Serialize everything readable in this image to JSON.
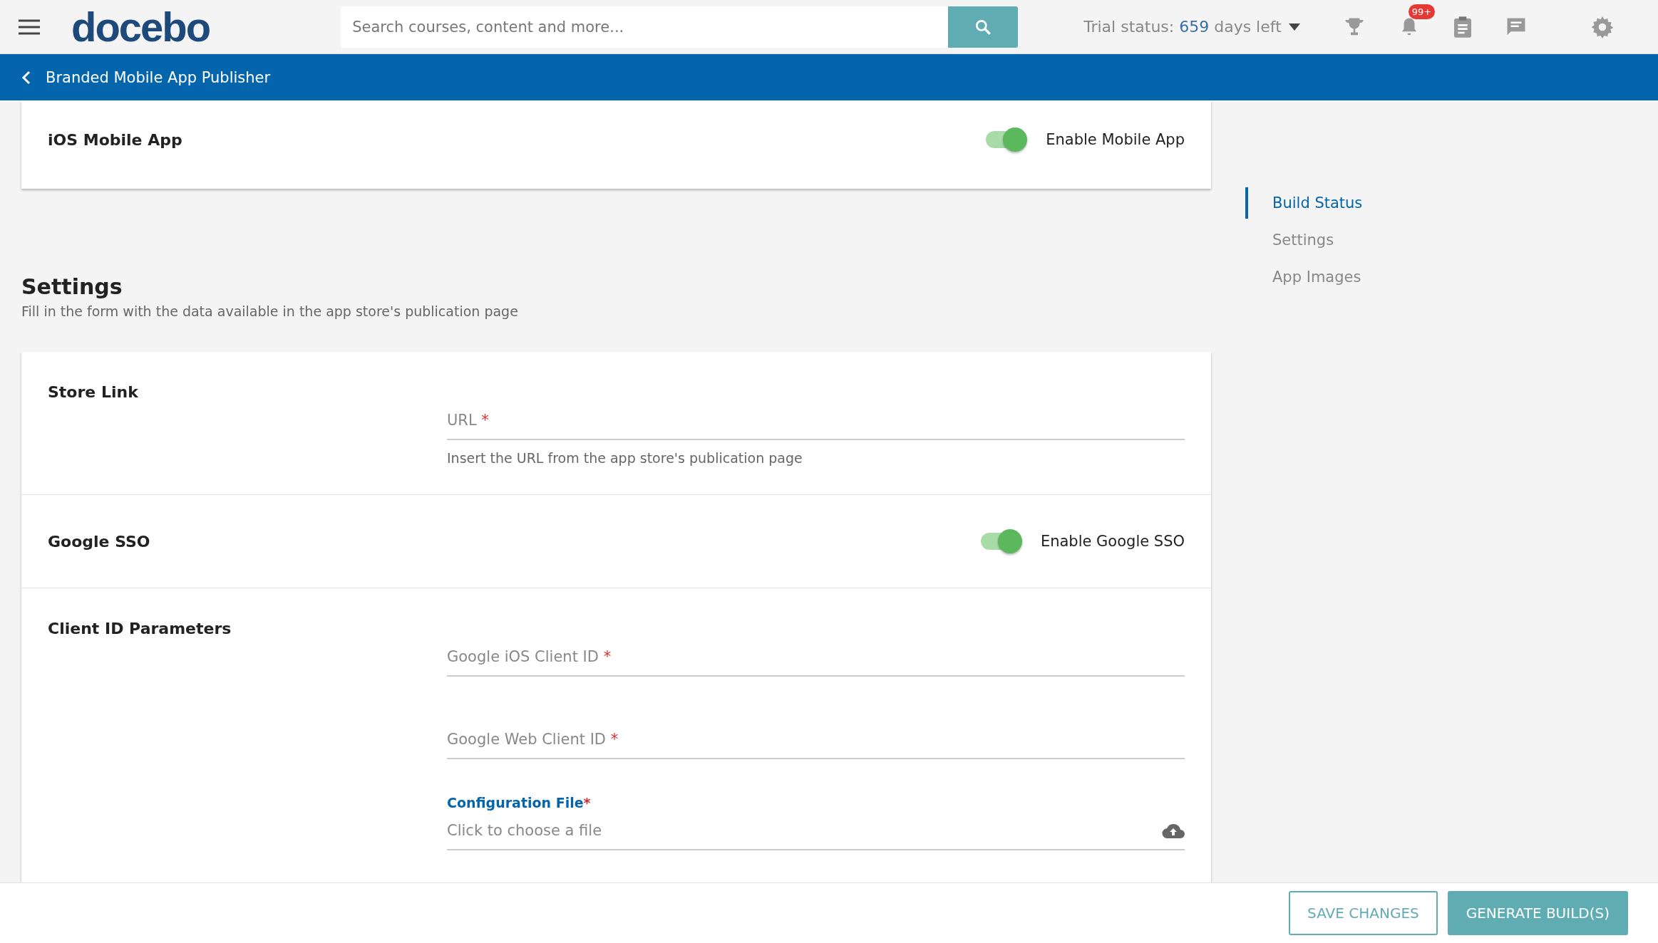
{
  "topbar": {
    "logo": "docebo",
    "search": {
      "placeholder": "Search courses, content and more..."
    },
    "trial": {
      "label": "Trial status:",
      "days": "659",
      "suffix": "days left"
    },
    "notifications_badge": "99+"
  },
  "header": {
    "title": "Branded Mobile App Publisher"
  },
  "app_card": {
    "title": "iOS Mobile App",
    "toggle": {
      "label": "Enable Mobile App",
      "on": true
    }
  },
  "settings": {
    "title": "Settings",
    "subtitle": "Fill in the form with the data available in the app store's publication page",
    "sections": [
      {
        "kind": "fields",
        "title": "Store Link",
        "fields": [
          {
            "placeholder": "URL",
            "required": "*",
            "hint": "Insert the URL from the app store's publication page"
          }
        ]
      },
      {
        "kind": "toggle",
        "title": "Google SSO",
        "toggle": {
          "label": "Enable Google SSO",
          "on": true
        }
      },
      {
        "kind": "fields",
        "title": "Client ID Parameters",
        "fields": [
          {
            "placeholder": "Google iOS Client ID",
            "required": "*"
          },
          {
            "placeholder": "Google Web Client ID",
            "required": "*"
          }
        ],
        "file": {
          "label": "Configuration File",
          "required": "*",
          "placeholder": "Click to choose a file"
        }
      }
    ]
  },
  "side_nav": [
    {
      "label": "Build Status",
      "selected": true
    },
    {
      "label": "Settings",
      "selected": false
    },
    {
      "label": "App Images",
      "selected": false
    }
  ],
  "footer": {
    "buttons": [
      {
        "label": "SAVE CHANGES",
        "kind": "outline"
      },
      {
        "label": "GENERATE BUILD(S)",
        "kind": "primary"
      }
    ]
  }
}
